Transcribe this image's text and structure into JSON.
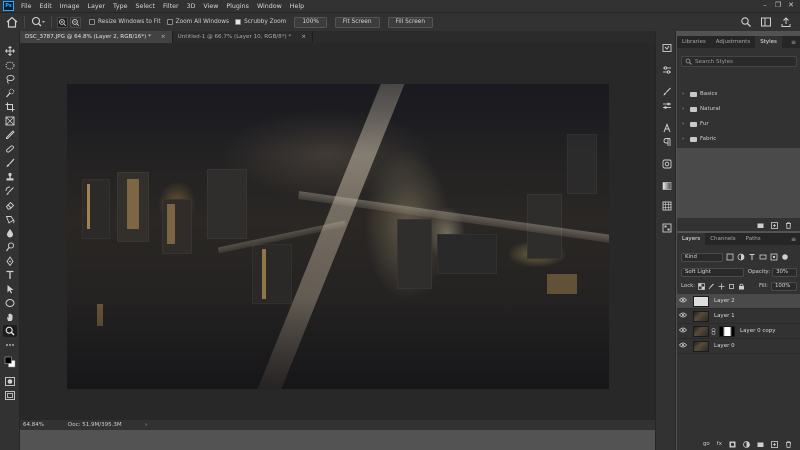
{
  "app": {
    "logo": "Ps"
  },
  "menu": [
    "File",
    "Edit",
    "Image",
    "Layer",
    "Type",
    "Select",
    "Filter",
    "3D",
    "View",
    "Plugins",
    "Window",
    "Help"
  ],
  "options": {
    "resize_windows": "Resize Windows to Fit",
    "resize_windows_checked": false,
    "zoom_all": "Zoom All Windows",
    "zoom_all_checked": false,
    "scrubby_zoom": "Scrubby Zoom",
    "scrubby_zoom_checked": true,
    "zoom_value": "100%",
    "fit_screen": "Fit Screen",
    "fill_screen": "Fill Screen"
  },
  "tabs": [
    {
      "label": "DSC_3787.JPG @ 64.8% (Layer 2, RGB/16*) *",
      "active": true
    },
    {
      "label": "Untitled-1 @ 66.7% (Layer 10, RGB/8*) *",
      "active": false
    }
  ],
  "status": {
    "zoom": "64.84%",
    "doc": "Doc: 51.9M/395.3M",
    "arrow": "›"
  },
  "styles_panel": {
    "tabs": [
      "Libraries",
      "Adjustments",
      "Styles"
    ],
    "active_tab": "Styles",
    "search_placeholder": "Search Styles",
    "folders": [
      "Basics",
      "Natural",
      "Fur",
      "Fabric"
    ]
  },
  "layers_panel": {
    "tabs": [
      "Layers",
      "Channels",
      "Paths"
    ],
    "active_tab": "Layers",
    "kind": "Kind",
    "blend_mode": "Soft Light",
    "opacity_label": "Opacity:",
    "opacity_value": "30%",
    "lock_label": "Lock:",
    "fill_label": "Fill:",
    "fill_value": "100%",
    "layers": [
      {
        "name": "Layer 2",
        "selected": true,
        "thumb": "white"
      },
      {
        "name": "Layer 1",
        "selected": false,
        "thumb": "photo"
      },
      {
        "name": "Layer 0 copy",
        "selected": false,
        "thumb": "photo",
        "mask": true
      },
      {
        "name": "Layer 0",
        "selected": false,
        "thumb": "photo"
      }
    ],
    "footer": [
      "go",
      "fx"
    ]
  },
  "colors": {
    "ui_bg": "#535353",
    "panel_bg": "#323232",
    "accent": "#31a8ff"
  }
}
